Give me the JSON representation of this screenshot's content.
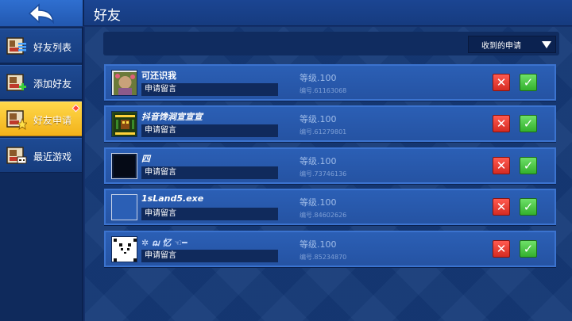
{
  "header": {
    "title": "好友",
    "back_icon": "back-arrow-icon"
  },
  "sidebar": {
    "items": [
      {
        "label": "好友列表",
        "icon": "friend-list-icon",
        "active": false
      },
      {
        "label": "添加好友",
        "icon": "add-friend-icon",
        "active": false
      },
      {
        "label": "好友申请",
        "icon": "friend-request-icon",
        "active": true,
        "notification": true
      },
      {
        "label": "最近游戏",
        "icon": "recent-games-icon",
        "active": false
      }
    ]
  },
  "filter": {
    "selected": "收到的申请"
  },
  "requests": [
    {
      "name": "可还识我",
      "message": "申请留言",
      "level": "等级.100",
      "uid": "编号.61163068",
      "avatar": "photo-avatar"
    },
    {
      "name": "抖音馋涧宣宣宣",
      "message": "申请留言",
      "level": "等级.100",
      "uid": "编号.61279801",
      "avatar": "pixel-art-avatar"
    },
    {
      "name": "四",
      "message": "申请留言",
      "level": "等级.100",
      "uid": "编号.73746136",
      "avatar": "black-avatar"
    },
    {
      "name": "1sLand5.exe",
      "message": "申请留言",
      "level": "等级.100",
      "uid": "编号.84602626",
      "avatar": "empty-avatar"
    },
    {
      "name": "✲ ฌ 忆 ☜━",
      "message": "申请留言",
      "level": "等级.100",
      "uid": "编号.85234870",
      "avatar": "panda-avatar"
    }
  ],
  "colors": {
    "background": "#163a78",
    "card": "#2b5fb5",
    "active_tab": "#f2b21a",
    "reject": "#d52b22",
    "accept": "#33b02c"
  }
}
